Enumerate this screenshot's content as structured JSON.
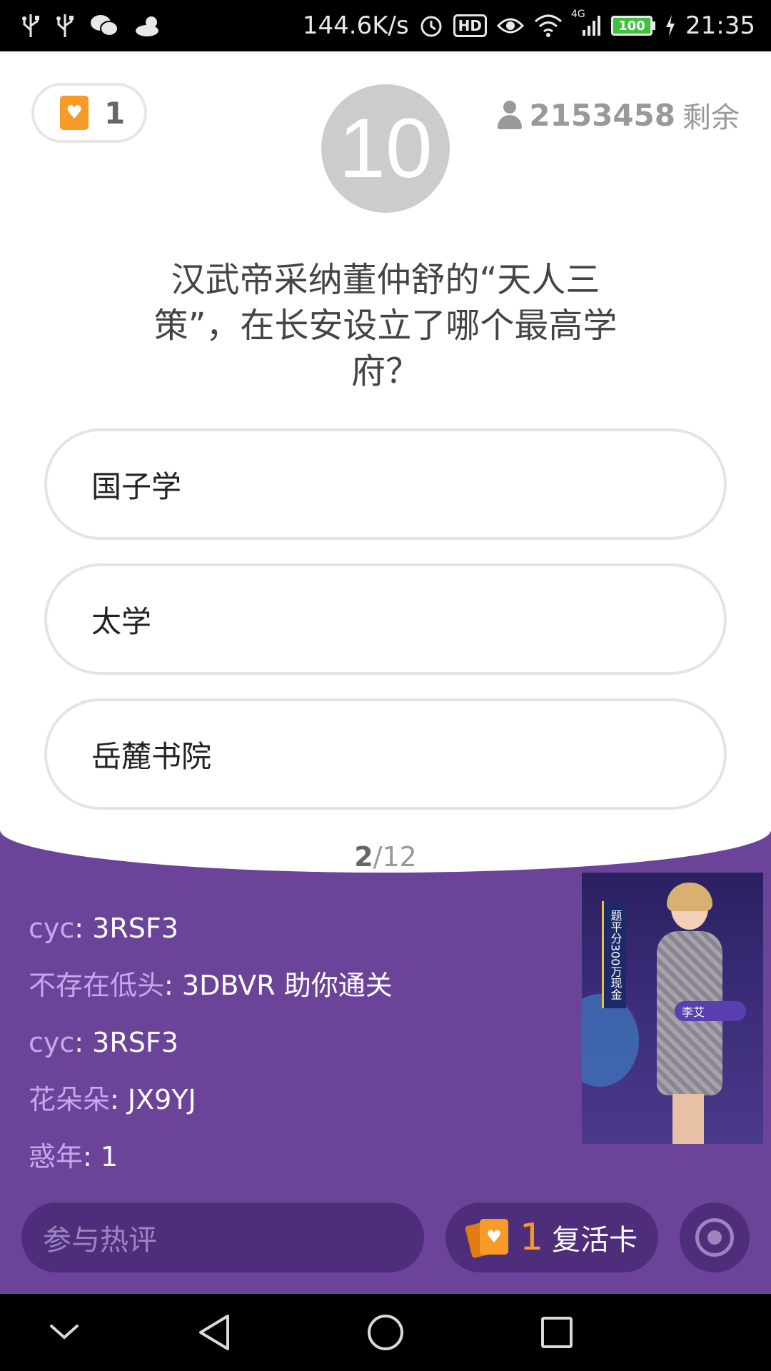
{
  "status_bar": {
    "network_speed": "144.6K/s",
    "hd_label": "HD",
    "network_type": "4G",
    "battery": "100",
    "time": "21:35"
  },
  "quiz": {
    "lives": "1",
    "countdown": "10",
    "remaining_count": "2153458",
    "remaining_label": "剩余",
    "question": "汉武帝采纳董仲舒的“天人三策”，在长安设立了哪个最高学府？",
    "options": [
      {
        "label": "国子学"
      },
      {
        "label": "太学"
      },
      {
        "label": "岳麓书院"
      }
    ],
    "progress_current": "2",
    "progress_total": "/12"
  },
  "comments": [
    {
      "user": "cyc",
      "text": ": 3RSF3"
    },
    {
      "user": "不存在低头",
      "text": ": 3DBVR 助你通关"
    },
    {
      "user": "cyc",
      "text": ": 3RSF3"
    },
    {
      "user": "花朵朵",
      "text": ": JX9YJ"
    },
    {
      "user": "惑年",
      "text": ": 1"
    }
  ],
  "video": {
    "banner_text": "题平分300万现金",
    "host_tag": "李艾"
  },
  "bottom_bar": {
    "comment_placeholder": "参与热评",
    "revive_count": "1",
    "revive_label": "复活卡"
  },
  "colors": {
    "background_purple": "#6b4398",
    "accent_orange": "#f79a27",
    "username_lilac": "#c5a8ee"
  },
  "icons": [
    "usb-icon",
    "wechat-icon",
    "weather-icon",
    "alarm-icon",
    "eye-icon",
    "wifi-icon",
    "signal-icon",
    "battery-icon",
    "heart-card-icon",
    "person-icon",
    "record-icon",
    "nav-down-icon",
    "nav-back-icon",
    "nav-home-icon",
    "nav-recents-icon"
  ]
}
